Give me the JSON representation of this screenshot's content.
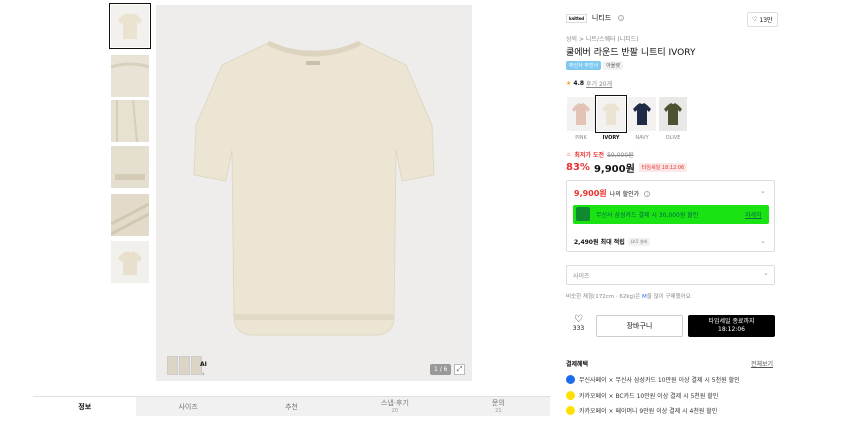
{
  "product": {
    "brand": "니티드",
    "brand_logo": "knitted",
    "likes": "13만",
    "breadcrumb": "상의 > 니트/스웨터 (니티드)",
    "title": "쿨에버 라운드 반팔 니트티 IVORY",
    "tags": [
      "무신사 무진사",
      "아울렛"
    ],
    "rating": "4.8",
    "reviews": "후기 20개",
    "colors": [
      "PINK",
      "IVORY",
      "NAVY",
      "OLIVE"
    ],
    "selected_color": "IVORY",
    "max_benefit_label": "최저가 도전",
    "original_price": "59,000원",
    "discount": "83%",
    "price": "9,900원",
    "timer_label": "타임세일 18:12:06",
    "my_price": "9,900원",
    "my_price_label": "나의 할인가",
    "card_banner": "무신사 삼성카드 결제 시 30,000원 할인",
    "card_banner_link": "자세히",
    "points": "2,490원 최대 적립",
    "level_badge": "LV.5 실버",
    "size_placeholder": "사이즈",
    "size_note_prefix": "비슷한 체형(172cm · 62kg)은",
    "size_note_size": "M",
    "size_note_suffix": "을 많이 구매했어요",
    "heart_count": "333",
    "cart_label": "장바구니",
    "buy_label_1": "타임세일 종료까지",
    "buy_label_2": "18:12:06"
  },
  "gallery": {
    "counter": "1 / 6",
    "ai_label": "AI",
    "zoom_icon": "expand-icon"
  },
  "tabs": [
    {
      "label": "정보",
      "sub": ""
    },
    {
      "label": "사이즈",
      "sub": ""
    },
    {
      "label": "추천",
      "sub": ""
    },
    {
      "label": "스냅·후기",
      "sub": "20"
    },
    {
      "label": "문의",
      "sub": "21"
    }
  ],
  "benefits": {
    "title": "결제혜택",
    "more": "전체보기",
    "items": [
      "무신사페이 × 무신사 삼성카드 10만원 이상 결제 시 5천원 할인",
      "카카오페이 × BC카드 10만원 이상 결제 시 5천원 할인",
      "카카오페이 × 페이머니 9만원 이상 결제 시 4천원 할인"
    ]
  },
  "colors_hex": {
    "ivory": "#ece4d2",
    "pink": "#e2c3b6",
    "navy": "#1f2a45",
    "olive": "#4c5232",
    "accent_red": "#e8332f",
    "banner_green": "#19e313"
  }
}
